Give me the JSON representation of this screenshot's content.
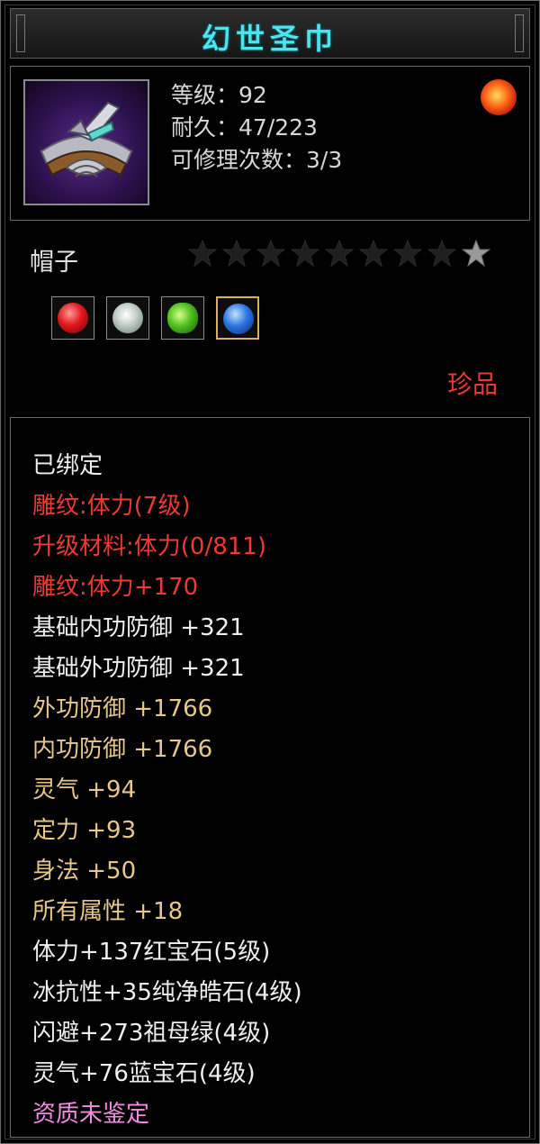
{
  "item": {
    "name": "幻世圣巾",
    "stats": {
      "level": "等级：92",
      "durability": "耐久：47/223",
      "repairs": "可修理次数：3/3"
    },
    "type": "帽子",
    "stars": {
      "filled": 1,
      "total": 9
    },
    "gems": [
      "ruby-gem-icon",
      "diamond-gem-icon",
      "emerald-gem-icon",
      "sapphire-gem-icon"
    ],
    "rarity": "珍品"
  },
  "properties": [
    {
      "text": "已绑定",
      "color": "white"
    },
    {
      "text": "雕纹:体力(7级)",
      "color": "red"
    },
    {
      "text": "升级材料:体力(0/811)",
      "color": "red"
    },
    {
      "text": "雕纹:体力+170",
      "color": "red"
    },
    {
      "text": "基础内功防御 +321",
      "color": "white"
    },
    {
      "text": "基础外功防御 +321",
      "color": "white"
    },
    {
      "text": "外功防御 +1766",
      "color": "gold"
    },
    {
      "text": "内功防御 +1766",
      "color": "gold"
    },
    {
      "text": "灵气 +94",
      "color": "gold"
    },
    {
      "text": "定力 +93",
      "color": "gold"
    },
    {
      "text": "身法 +50",
      "color": "gold"
    },
    {
      "text": "所有属性 +18",
      "color": "gold"
    },
    {
      "text": "体力+137红宝石(5级)",
      "color": "white"
    },
    {
      "text": "冰抗性+35纯净皓石(4级)",
      "color": "white"
    },
    {
      "text": "闪避+273祖母绿(4级)",
      "color": "white"
    },
    {
      "text": "灵气+76蓝宝石(4级)",
      "color": "white"
    },
    {
      "text": "资质未鉴定",
      "color": "pink"
    }
  ],
  "colors": {
    "title": "#4fe3ee",
    "red": "#ee3a30",
    "gold": "#e7c78a",
    "pink": "#f08de0",
    "white": "#efefef"
  }
}
